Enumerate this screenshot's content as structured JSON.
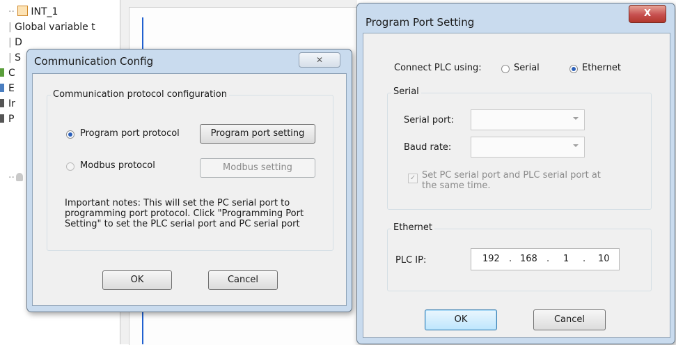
{
  "tree": {
    "items": [
      {
        "prefix": "-",
        "label": "INT_1"
      },
      {
        "prefix": "|",
        "label": "Global variable t"
      },
      {
        "prefix": "|",
        "label": "D"
      },
      {
        "prefix": "|",
        "label": "S"
      },
      {
        "prefix": "",
        "label": "C"
      },
      {
        "prefix": "",
        "label": "E"
      },
      {
        "prefix": "",
        "label": "Ir"
      },
      {
        "prefix": "",
        "label": "P"
      }
    ]
  },
  "comm_dialog": {
    "title": "Communication Config",
    "close_glyph": "✕",
    "group_label": "Communication protocol configuration",
    "program_port_protocol": "Program port protocol",
    "program_port_setting": "Program port setting",
    "modbus_protocol": "Modbus protocol",
    "modbus_setting": "Modbus setting",
    "note_line1": "Important notes: This will set the PC serial port to",
    "note_line2": "programming port protocol. Click \"Programming Port",
    "note_line3": "Setting\" to set the PLC serial port and PC serial port",
    "ok": "OK",
    "cancel": "Cancel"
  },
  "port_dialog": {
    "title": "Program Port Setting",
    "close_glyph": "X",
    "connect_label": "Connect PLC using:",
    "serial_option": "Serial",
    "ethernet_option": "Ethernet",
    "serial_group": "Serial",
    "serial_port_label": "Serial port:",
    "baud_rate_label": "Baud rate:",
    "sync_line1": "Set PC serial port and PLC serial port at",
    "sync_line2": "the same time.",
    "ethernet_group": "Ethernet",
    "plc_ip_label": "PLC IP:",
    "ip": {
      "a": "192",
      "b": "168",
      "c": "1",
      "d": "10",
      "dot": "."
    },
    "ok": "OK",
    "cancel": "Cancel"
  },
  "colors": {
    "accent": "#2b5fb8",
    "close_red": "#c75050"
  }
}
